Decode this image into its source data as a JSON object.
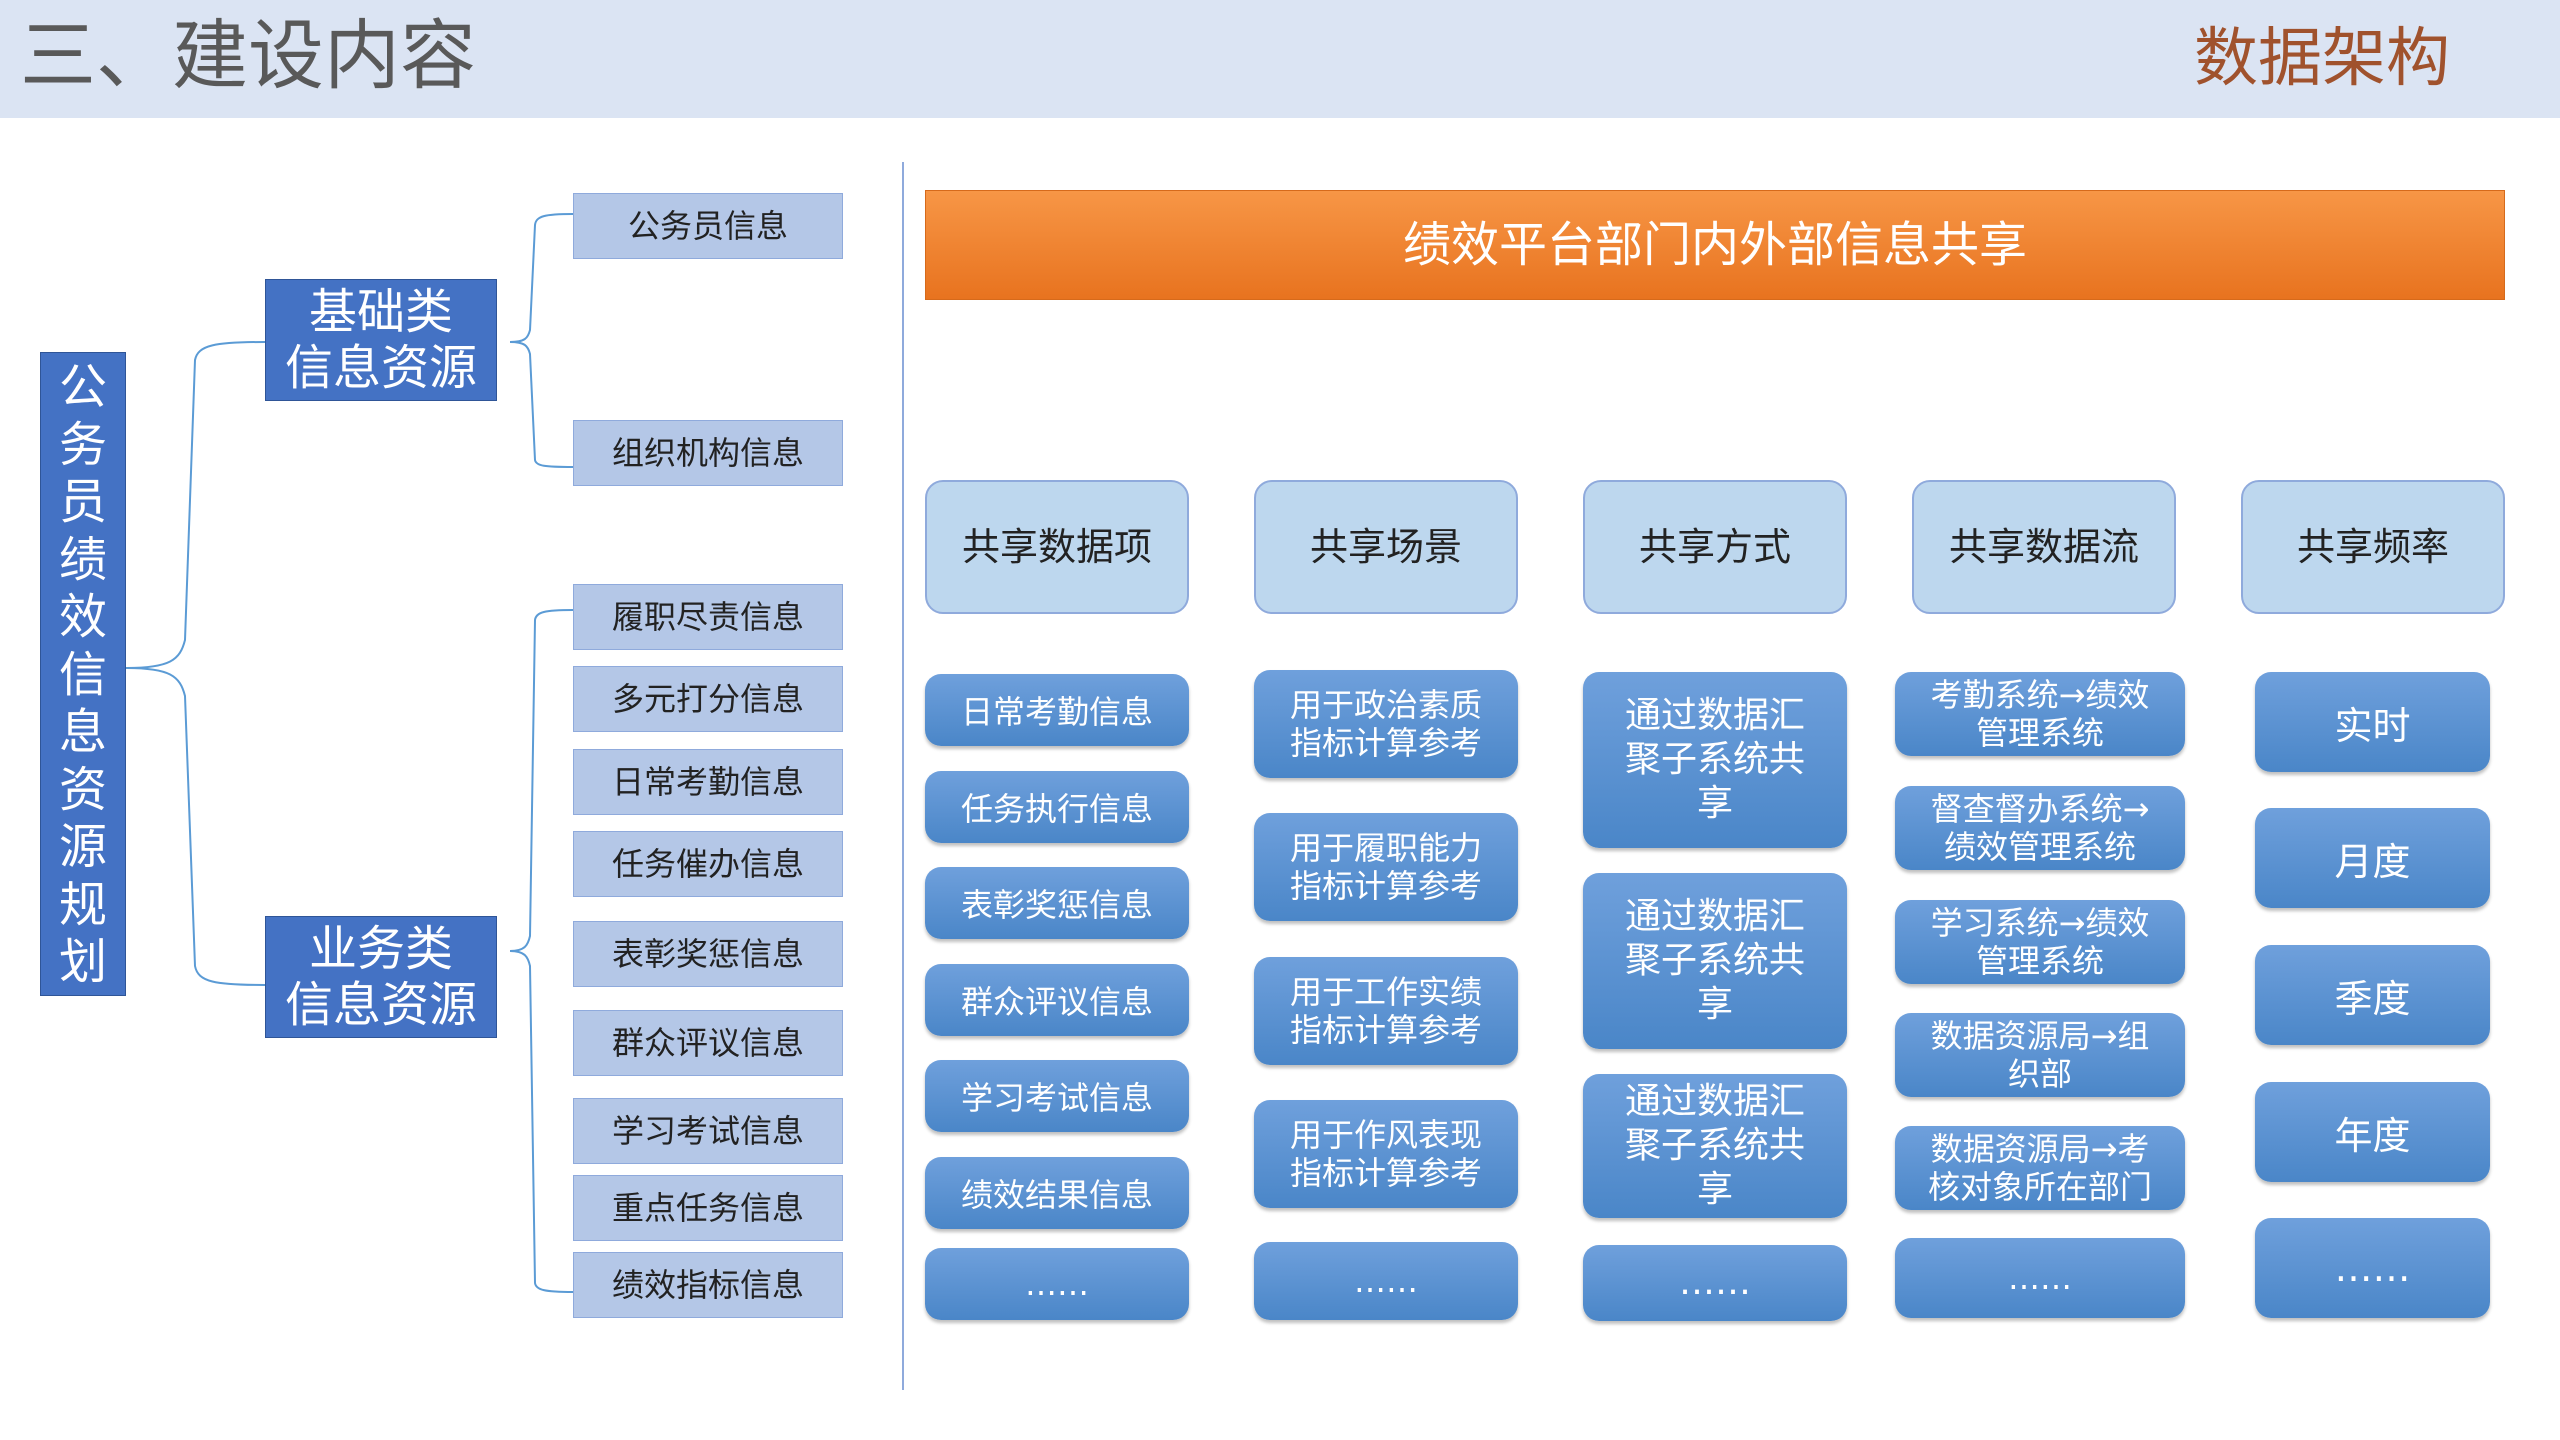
{
  "header": {
    "title": "三、建设内容",
    "subtitle": "数据架构"
  },
  "root": {
    "label": [
      "公",
      "务",
      "员",
      "绩",
      "效",
      "信",
      "息",
      "资",
      "源",
      "规",
      "划"
    ]
  },
  "categories": [
    {
      "label": [
        "基础类",
        "信息资源"
      ],
      "items": [
        "公务员信息",
        "组织机构信息"
      ]
    },
    {
      "label": [
        "业务类",
        "信息资源"
      ],
      "items": [
        "履职尽责信息",
        "多元打分信息",
        "日常考勤信息",
        "任务催办信息",
        "表彰奖惩信息",
        "群众评议信息",
        "学习考试信息",
        "重点任务信息",
        "绩效指标信息"
      ]
    }
  ],
  "banner": "绩效平台部门内外部信息共享",
  "columns": [
    {
      "header": "共享数据项",
      "items": [
        "日常考勤信息",
        "任务执行信息",
        "表彰奖惩信息",
        "群众评议信息",
        "学习考试信息",
        "绩效结果信息",
        "……"
      ]
    },
    {
      "header": "共享场景",
      "items": [
        "用于政治素质指标计算参考",
        "用于履职能力指标计算参考",
        "用于工作实绩指标计算参考",
        "用于作风表现指标计算参考",
        "……"
      ]
    },
    {
      "header": "共享方式",
      "items": [
        "通过数据汇聚子系统共享",
        "通过数据汇聚子系统共享",
        "通过数据汇聚子系统共享",
        "……"
      ]
    },
    {
      "header": "共享数据流",
      "items": [
        "考勤系统→绩效管理系统",
        "督查督办系统→绩效管理系统",
        "学习系统→绩效管理系统",
        "数据资源局→组织部",
        "数据资源局→考核对象所在部门",
        "……"
      ]
    },
    {
      "header": "共享频率",
      "items": [
        "实时",
        "月度",
        "季度",
        "年度",
        "……"
      ]
    }
  ]
}
